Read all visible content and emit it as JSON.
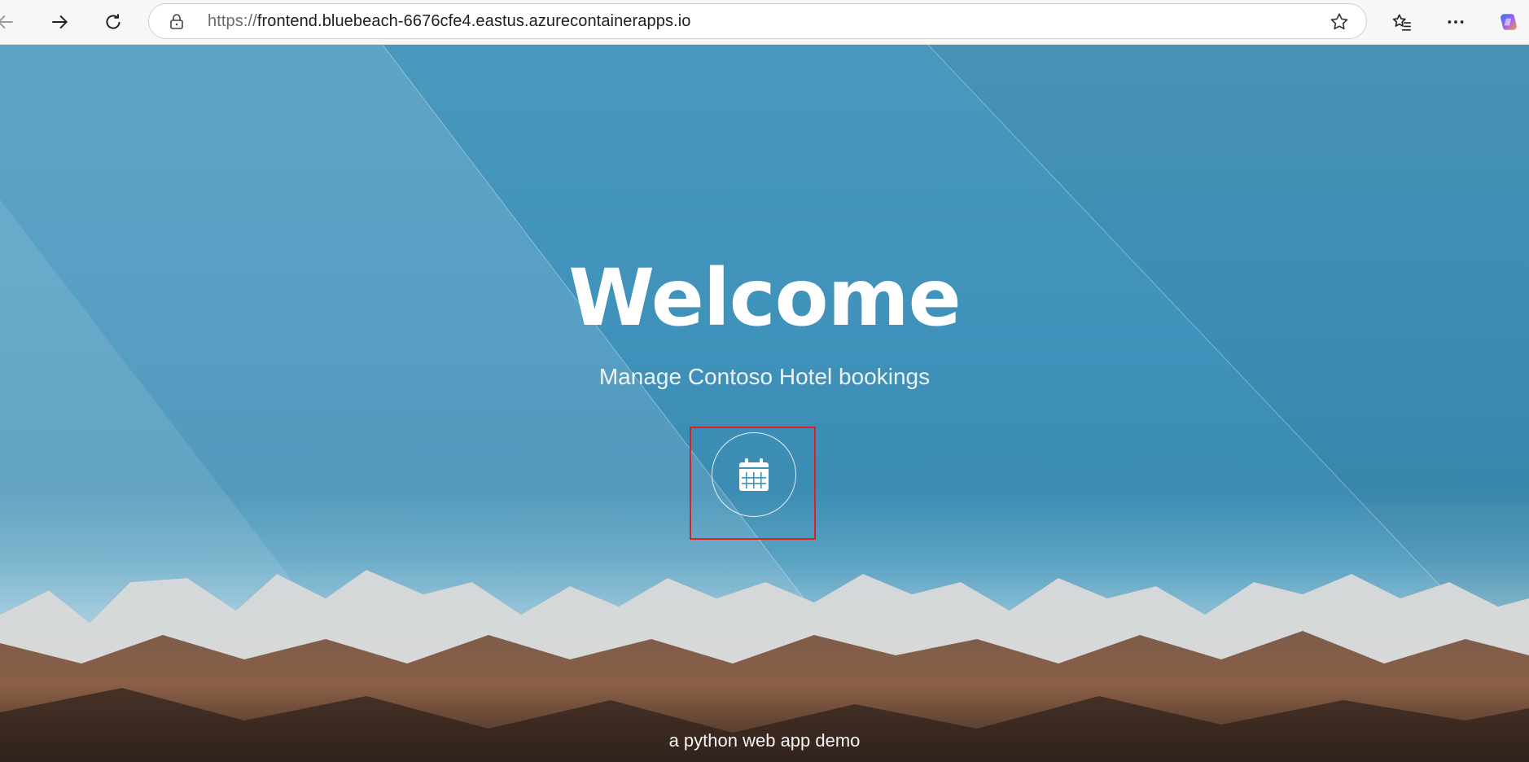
{
  "browser": {
    "url_scheme": "https://",
    "url_host": "frontend.bluebeach-6676cfe4.eastus.azurecontainerapps.io",
    "icons": [
      "back-arrow-icon",
      "forward-arrow-icon",
      "refresh-icon",
      "lock-icon",
      "favorite-star-icon",
      "favorites-list-icon",
      "more-menu-icon",
      "copilot-icon"
    ]
  },
  "hero": {
    "title": "Welcome",
    "subtitle": "Manage Contoso Hotel bookings",
    "action_icon": "calendar-icon",
    "footer": "a python web app demo"
  },
  "colors": {
    "highlight": "#e02020",
    "sky": "#3f92bb"
  }
}
